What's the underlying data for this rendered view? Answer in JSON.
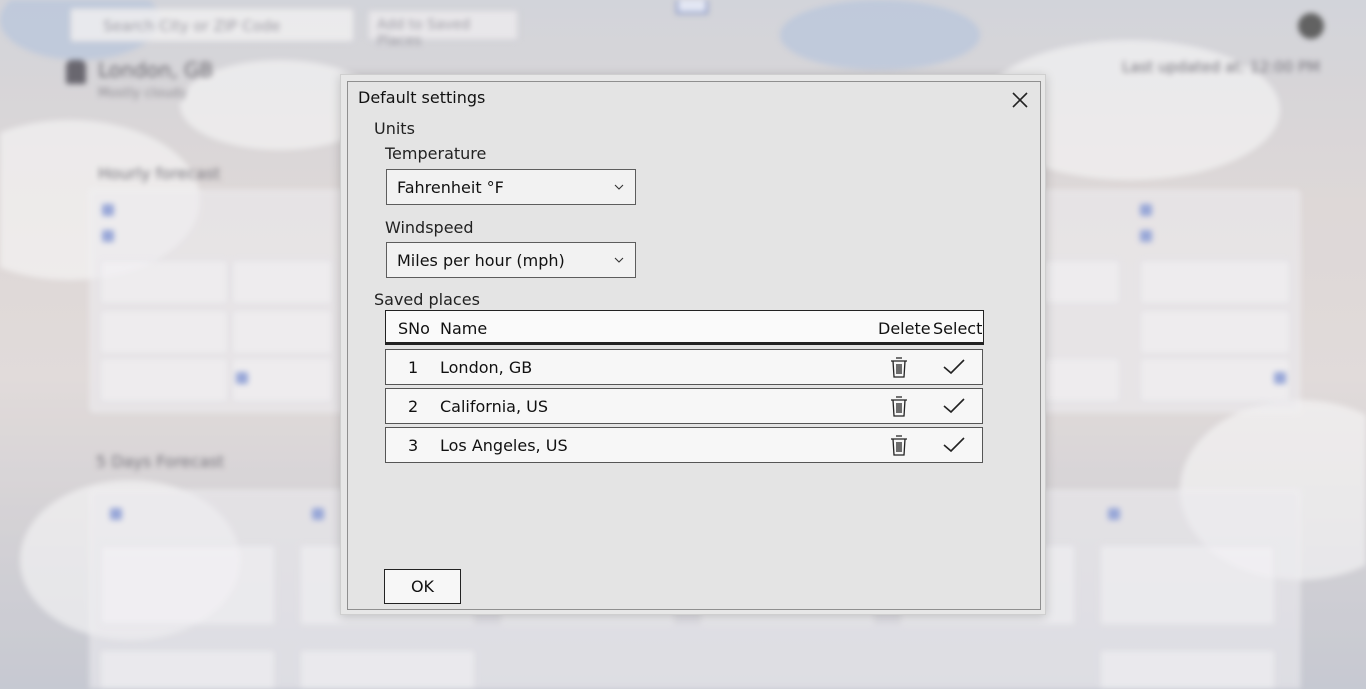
{
  "background": {
    "search_placeholder": "Search City or ZIP Code",
    "add_button": "Add to Saved Places",
    "city": "London, GB",
    "city_sub": "Mostly cloudy",
    "updated": "Last updated at: 12:00 PM",
    "hourly_title": "Hourly forecast",
    "daily_title": "5 Days Forecast"
  },
  "dialog": {
    "title": "Default settings",
    "units_label": "Units",
    "temperature_label": "Temperature",
    "temperature_value": "Fahrenheit °F",
    "windspeed_label": "Windspeed",
    "windspeed_value": "Miles per hour (mph)",
    "saved_places_label": "Saved places",
    "columns": {
      "sno": "SNo",
      "name": "Name",
      "delete": "Delete",
      "select": "Select"
    },
    "places": [
      {
        "sno": "1",
        "name": "London, GB"
      },
      {
        "sno": "2",
        "name": "California, US"
      },
      {
        "sno": "3",
        "name": "Los Angeles, US"
      }
    ],
    "ok_label": "OK"
  },
  "icons": {
    "close": "close-icon",
    "dropdown": "chevron-down-icon",
    "delete": "trash-icon",
    "select": "checkmark-icon"
  }
}
